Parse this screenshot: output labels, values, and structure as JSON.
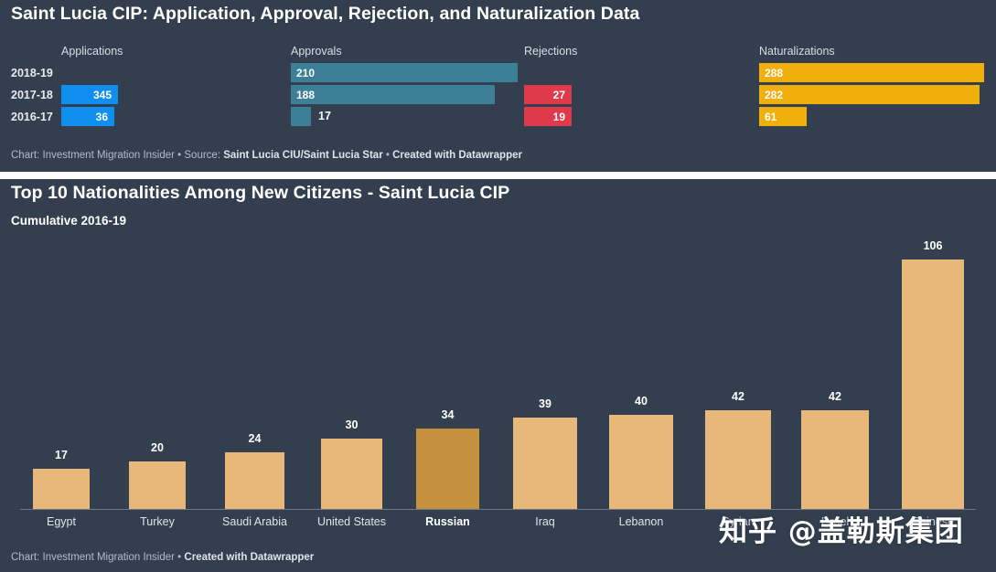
{
  "theme": {
    "background": "#333f4f",
    "page_background": "#ffffff",
    "applications_color": "#0f8ff0",
    "approvals_color": "#3d7f96",
    "rejections_color": "#e0394c",
    "naturalizations_color": "#efaf0c",
    "bar_color": "#e8b87a",
    "bar_highlight_color": "#c5913f",
    "text_color": "#ffffff"
  },
  "chart1": {
    "title": "Saint Lucia CIP: Application, Approval, Rejection, and Naturalization Data",
    "credit_prefix": "Chart: Investment Migration Insider • Source: ",
    "credit_source": "Saint Lucia CIU/Saint Lucia Star",
    "credit_mid": " • ",
    "credit_tool": "Created with Datawrapper"
  },
  "chart2": {
    "title": "Top 10 Nationalities Among New Citizens - Saint Lucia CIP",
    "subtitle": "Cumulative 2016-19",
    "credit_prefix": "Chart: Investment Migration Insider • ",
    "credit_tool": "Created with Datawrapper"
  },
  "watermark": {
    "text": "知乎 @盖勒斯集团"
  },
  "chart_data": [
    {
      "type": "bar",
      "orientation": "horizontal",
      "title": "Saint Lucia CIP: Application, Approval, Rejection, and Naturalization Data",
      "xlabel": "",
      "ylabel": "",
      "grid": false,
      "legend": "column-headers",
      "categories": [
        "2018-19",
        "2017-18",
        "2016-17"
      ],
      "series": [
        {
          "name": "Applications",
          "color": "#0f8ff0",
          "values": [
            null,
            345,
            36
          ]
        },
        {
          "name": "Approvals",
          "color": "#3d7f96",
          "values": [
            210,
            188,
            17
          ]
        },
        {
          "name": "Rejections",
          "color": "#e0394c",
          "values": [
            null,
            27,
            19
          ]
        },
        {
          "name": "Naturalizations",
          "color": "#efaf0c",
          "values": [
            288,
            282,
            61
          ]
        }
      ]
    },
    {
      "type": "bar",
      "orientation": "vertical",
      "title": "Top 10 Nationalities Among New Citizens - Saint Lucia CIP",
      "subtitle": "Cumulative 2016-19",
      "xlabel": "",
      "ylabel": "",
      "grid": false,
      "ylim": [
        0,
        106
      ],
      "highlight": "Russian",
      "categories": [
        "Egypt",
        "Turkey",
        "Saudi Arabia",
        "United States",
        "Russian",
        "Iraq",
        "Lebanon",
        "Syrian",
        "Israel",
        "Chinese"
      ],
      "values": [
        17,
        20,
        24,
        30,
        34,
        39,
        40,
        42,
        42,
        106
      ]
    }
  ]
}
